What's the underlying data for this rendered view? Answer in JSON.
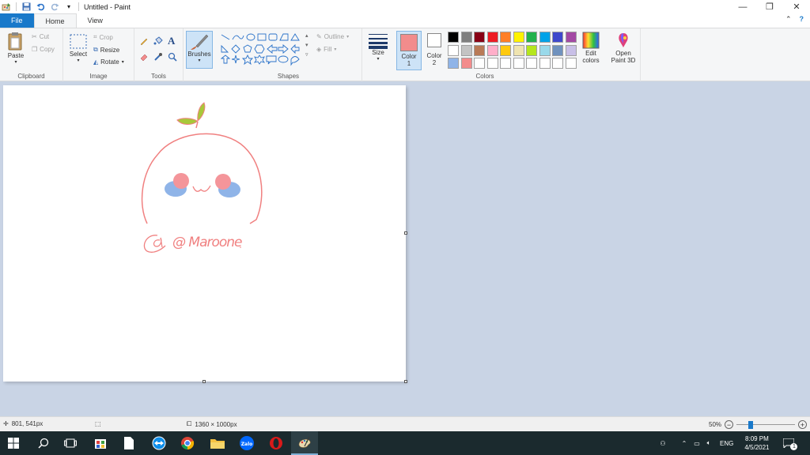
{
  "window": {
    "title": "Untitled - Paint",
    "controls": {
      "minimize": "—",
      "maximize": "❐",
      "close": "✕"
    }
  },
  "tabs": {
    "file": "File",
    "home": "Home",
    "view": "View"
  },
  "ribbon": {
    "clipboard": {
      "label": "Clipboard",
      "paste": "Paste",
      "cut": "Cut",
      "copy": "Copy"
    },
    "image": {
      "label": "Image",
      "select": "Select",
      "crop": "Crop",
      "resize": "Resize",
      "rotate": "Rotate"
    },
    "tools": {
      "label": "Tools"
    },
    "brushes": {
      "label": "Brushes"
    },
    "shapes": {
      "label": "Shapes",
      "outline": "Outline",
      "fill": "Fill"
    },
    "size": {
      "label": "Size"
    },
    "colors": {
      "label": "Colors",
      "color1_label": "Color",
      "color1_num": "1",
      "color2_label": "Color",
      "color2_num": "2",
      "color1": "#f28c8c",
      "color2": "#ffffff",
      "palette_row1": [
        "#000000",
        "#7f7f7f",
        "#880015",
        "#ed1c24",
        "#ff7f27",
        "#fff200",
        "#22b14c",
        "#00a2e8",
        "#3f48cc",
        "#a349a4"
      ],
      "palette_row2": [
        "#ffffff",
        "#c3c3c3",
        "#b97a57",
        "#ffaec9",
        "#ffc90e",
        "#efe4b0",
        "#b5e61d",
        "#99d9ea",
        "#7092be",
        "#c8bfe7"
      ],
      "palette_row3": [
        "#8fb4e8",
        "#f28c8c",
        "#ffffff",
        "#ffffff",
        "#ffffff",
        "#ffffff",
        "#ffffff",
        "#ffffff",
        "#ffffff",
        "#ffffff"
      ],
      "edit_colors_line1": "Edit",
      "edit_colors_line2": "colors",
      "open_paint3d_line1": "Open",
      "open_paint3d_line2": "Paint 3D"
    }
  },
  "status": {
    "cursor_pos": "801, 541px",
    "image_size": "1360 × 1000px",
    "zoom": "50%",
    "zoom_level": 0.5
  },
  "taskbar": {
    "time": "8:09 PM",
    "date": "4/5/2021",
    "lang": "ENG",
    "notification_count": "1",
    "zalo_label": "Zalo"
  },
  "drawing": {
    "signature_text": "@ Maroone"
  }
}
